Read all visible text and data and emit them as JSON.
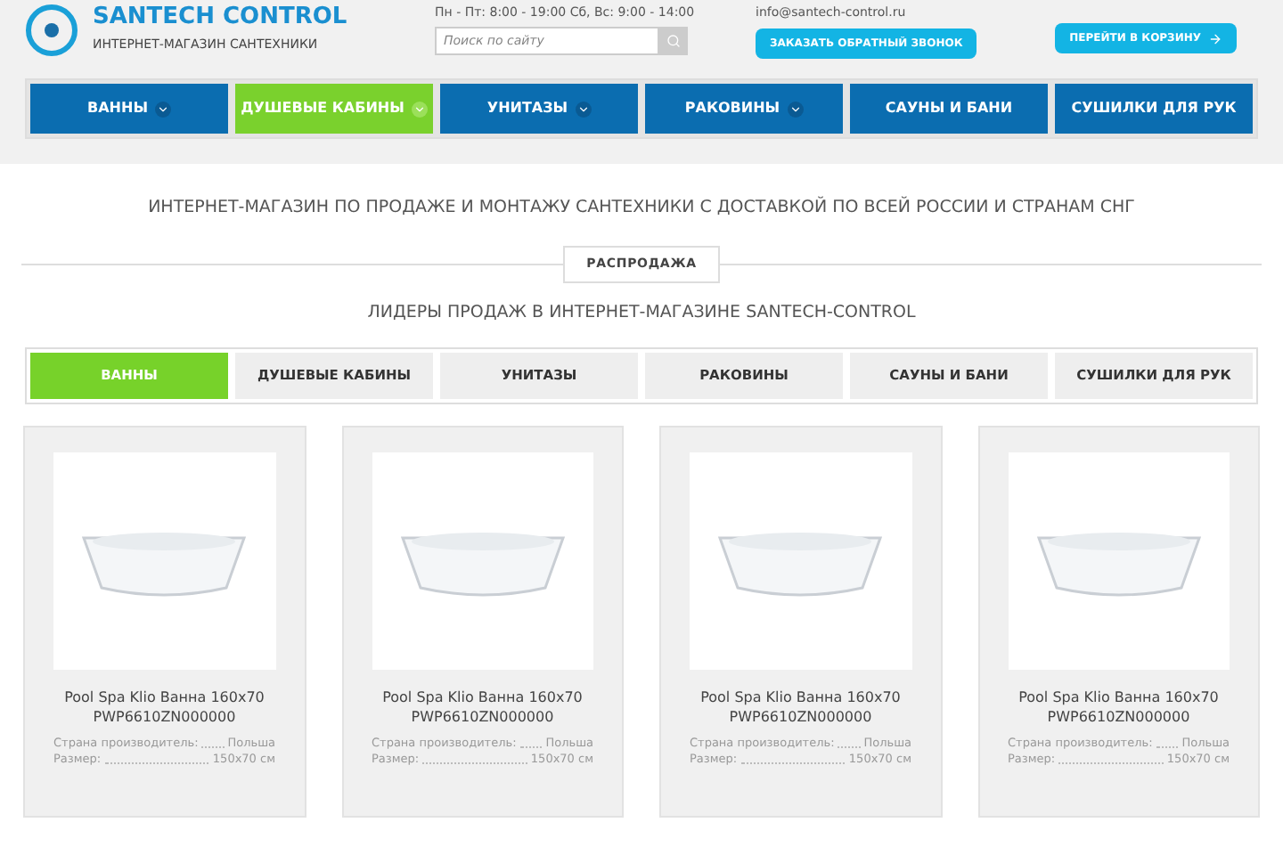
{
  "header": {
    "logo_text": "SANTECH CONTROL",
    "tagline": "ИНТЕРНЕТ-МАГАЗИН САНТЕХНИКИ",
    "hours": "Пн - Пт: 8:00 - 19:00 Сб, Вс: 9:00 - 14:00",
    "search": {
      "placeholder": "Поиск по сайту"
    },
    "email": "info@santech-control.ru",
    "callback_button": "ЗАКАЗАТЬ ОБРАТНЫЙ ЗВОНОК",
    "cart_button": "ПЕРЕЙТИ В КОРЗИНУ"
  },
  "nav": [
    {
      "label": "ВАННЫ",
      "selected": false,
      "dropdown": true
    },
    {
      "label": "ДУШЕВЫЕ КАБИНЫ",
      "selected": true,
      "dropdown": true
    },
    {
      "label": "УНИТАЗЫ",
      "selected": false,
      "dropdown": true
    },
    {
      "label": "РАКОВИНЫ",
      "selected": false,
      "dropdown": true
    },
    {
      "label": "САУНЫ И БАНИ",
      "selected": false,
      "dropdown": false
    },
    {
      "label": "СУШИЛКИ ДЛЯ РУК",
      "selected": false,
      "dropdown": false
    }
  ],
  "intro": "ИНТЕРНЕТ-МАГАЗИН ПО ПРОДАЖЕ И МОНТАЖУ САНТЕХНИКИ С ДОСТАВКОЙ ПО ВСЕЙ РОССИИ И СТРАНАМ СНГ",
  "section_badge": "РАСПРОДАЖА",
  "section_title": "ЛИДЕРЫ ПРОДАЖ В ИНТЕРНЕТ-МАГАЗИНЕ SANTECH-CONTROL",
  "tabs": [
    {
      "label": "ВАННЫ",
      "selected": true
    },
    {
      "label": "ДУШЕВЫЕ КАБИНЫ",
      "selected": false
    },
    {
      "label": "УНИТАЗЫ",
      "selected": false
    },
    {
      "label": "РАКОВИНЫ",
      "selected": false
    },
    {
      "label": "САУНЫ И БАНИ",
      "selected": false
    },
    {
      "label": "СУШИЛКИ ДЛЯ РУК",
      "selected": false
    }
  ],
  "products": [
    {
      "name": "Pool Spa Klio Ванна 160x70",
      "code": "PWP6610ZN000000",
      "specs": [
        {
          "label": "Страна производитель:",
          "value": "Польша"
        },
        {
          "label": "Размер:",
          "value": "150x70 см"
        }
      ]
    },
    {
      "name": "Pool Spa Klio Ванна 160x70",
      "code": "PWP6610ZN000000",
      "specs": [
        {
          "label": "Страна производитель:",
          "value": "Польша"
        },
        {
          "label": "Размер:",
          "value": "150x70 см"
        }
      ]
    },
    {
      "name": "Pool Spa Klio Ванна 160x70",
      "code": "PWP6610ZN000000",
      "specs": [
        {
          "label": "Страна производитель:",
          "value": "Польша"
        },
        {
          "label": "Размер:",
          "value": "150x70 см"
        }
      ]
    },
    {
      "name": "Pool Spa Klio Ванна 160x70",
      "code": "PWP6610ZN000000",
      "specs": [
        {
          "label": "Страна производитель:",
          "value": "Польша"
        },
        {
          "label": "Размер:",
          "value": "150x70 см"
        }
      ]
    }
  ]
}
